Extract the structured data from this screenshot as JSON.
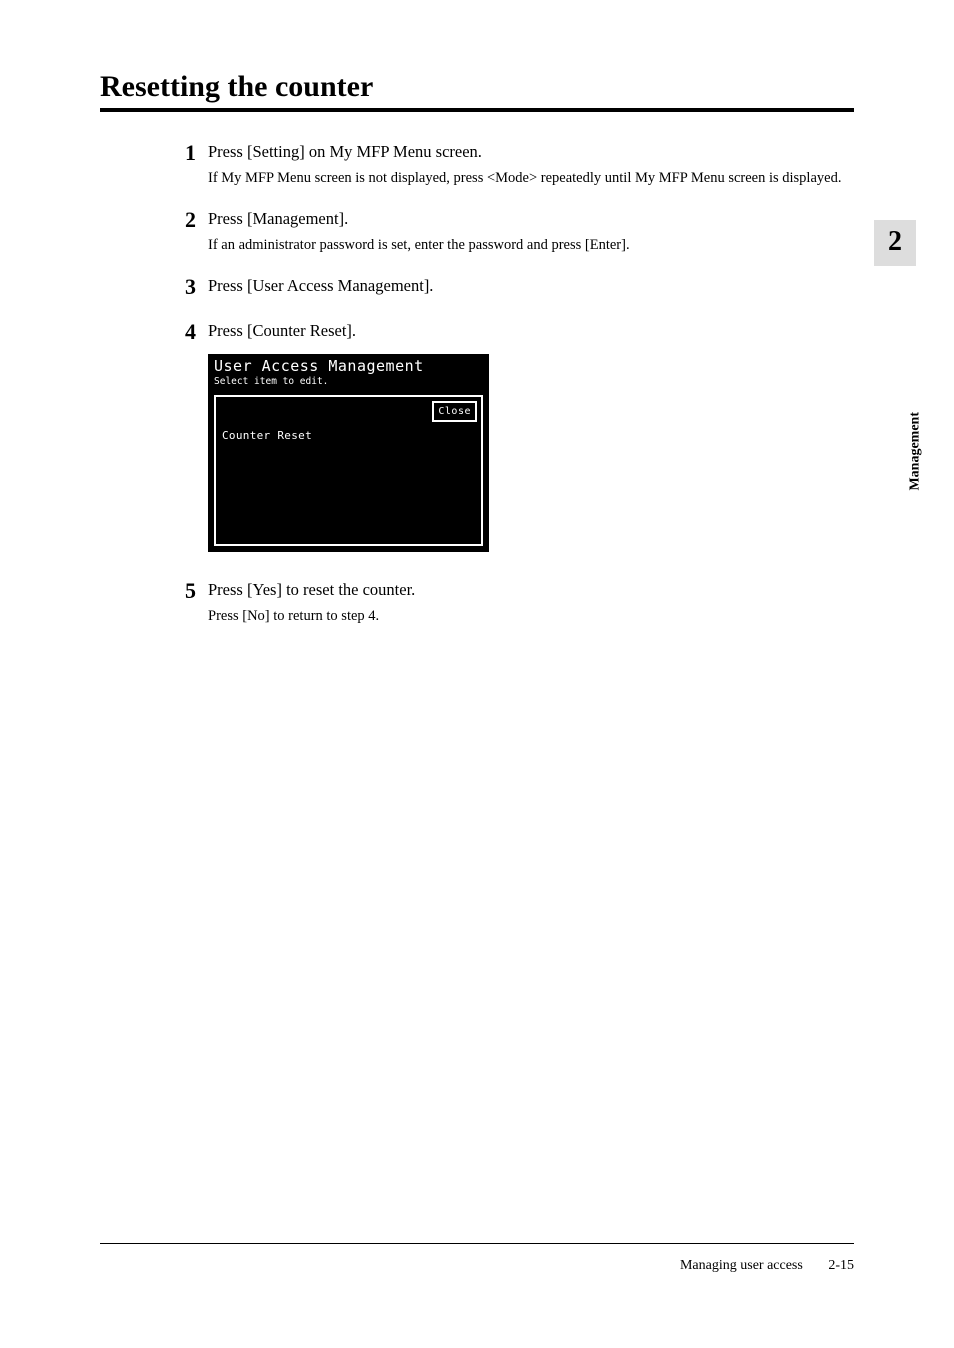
{
  "title": "Resetting the counter",
  "steps": [
    {
      "num": "1",
      "main": "Press [Setting] on My MFP Menu screen.",
      "sub": "If My MFP Menu screen is not displayed, press <Mode> repeatedly until My MFP Menu screen is displayed."
    },
    {
      "num": "2",
      "main": "Press [Management].",
      "sub": "If an administrator password is set, enter the password and press [Enter]."
    },
    {
      "num": "3",
      "main": "Press [User Access Management].",
      "sub": ""
    },
    {
      "num": "4",
      "main": "Press [Counter Reset].",
      "sub": ""
    },
    {
      "num": "5",
      "main": "Press [Yes] to reset the counter.",
      "sub": "Press [No] to return to step 4."
    }
  ],
  "lcd": {
    "title": "User Access Management",
    "subtitle": "Select item to edit.",
    "close_label": "Close",
    "item": "Counter Reset"
  },
  "side": {
    "chapter_num": "2",
    "chapter_label": "Management"
  },
  "footer": {
    "section": "Managing user access",
    "page": "2-15"
  }
}
